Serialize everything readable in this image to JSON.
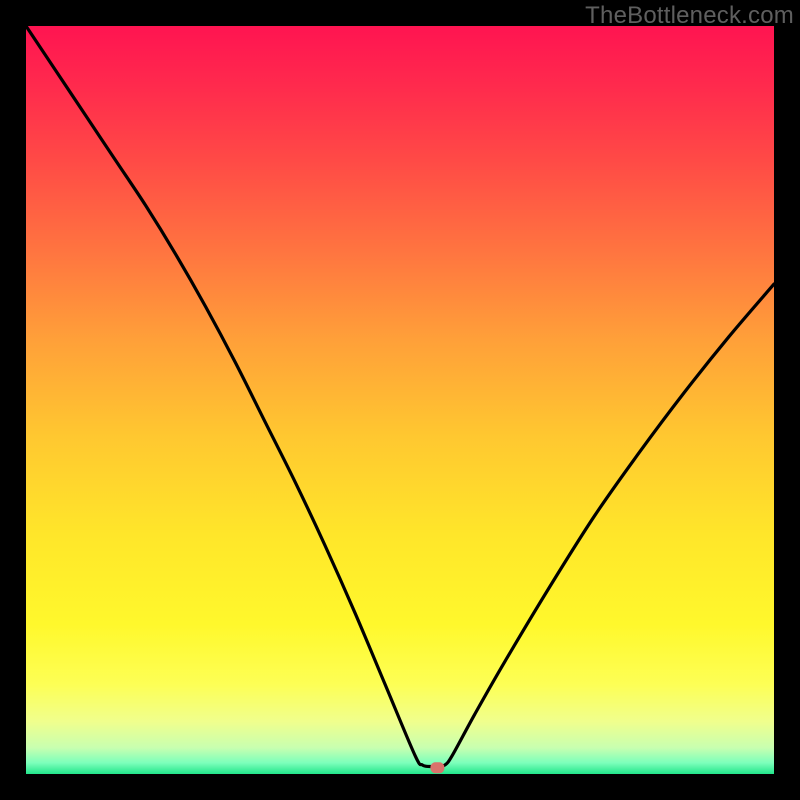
{
  "watermark": {
    "text": "TheBottleneck.com"
  },
  "chart_data": {
    "type": "line",
    "title": "",
    "xlabel": "",
    "ylabel": "",
    "xlim": [
      0,
      100
    ],
    "ylim": [
      0,
      100
    ],
    "grid": false,
    "series": [
      {
        "name": "bottleneck-curve",
        "x": [
          0,
          4,
          8,
          12,
          16,
          20,
          24,
          28,
          32,
          36,
          40,
          44,
          48,
          52,
          53,
          54,
          55,
          56,
          57,
          60,
          64,
          70,
          76,
          82,
          88,
          94,
          100
        ],
        "y": [
          100,
          94,
          88,
          82,
          76,
          69.5,
          62.5,
          55,
          47,
          39,
          30.5,
          21.5,
          12,
          2.5,
          1.2,
          1,
          1,
          1.2,
          2.5,
          8,
          15,
          25,
          34.5,
          43,
          51,
          58.5,
          65.5
        ]
      }
    ],
    "marker": {
      "x": 55,
      "y": 0.9,
      "color": "#d9726b"
    },
    "gradient_stops": [
      {
        "offset": 0.0,
        "color": "#ff1451"
      },
      {
        "offset": 0.08,
        "color": "#ff2a4d"
      },
      {
        "offset": 0.18,
        "color": "#ff4a46"
      },
      {
        "offset": 0.3,
        "color": "#ff7440"
      },
      {
        "offset": 0.42,
        "color": "#ffa039"
      },
      {
        "offset": 0.55,
        "color": "#ffc830"
      },
      {
        "offset": 0.68,
        "color": "#ffe62a"
      },
      {
        "offset": 0.8,
        "color": "#fff82c"
      },
      {
        "offset": 0.88,
        "color": "#fdff55"
      },
      {
        "offset": 0.93,
        "color": "#f0ff8d"
      },
      {
        "offset": 0.965,
        "color": "#c8ffb0"
      },
      {
        "offset": 0.985,
        "color": "#7dffbb"
      },
      {
        "offset": 1.0,
        "color": "#22e58b"
      }
    ]
  }
}
